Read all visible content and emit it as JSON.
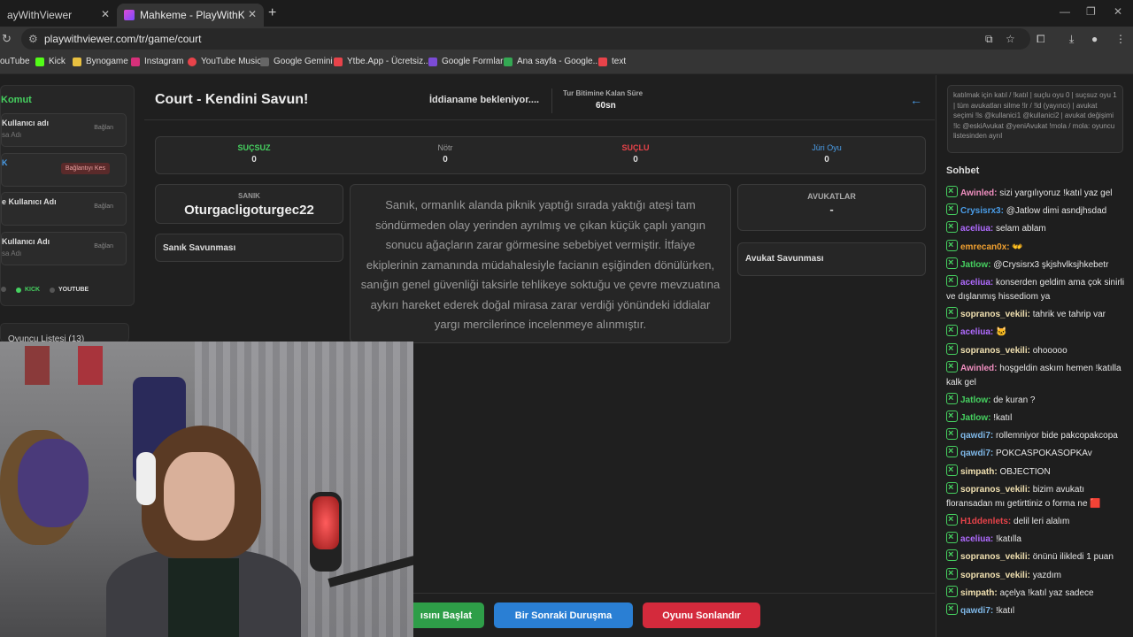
{
  "browser": {
    "tabs": [
      {
        "label": "ayWithViewer"
      },
      {
        "label": "Mahkeme - PlayWithKick | Play"
      }
    ],
    "url": "playwithviewer.com/tr/game/court",
    "bookmarks": [
      "ouTube",
      "Kick",
      "Bynogame",
      "Instagram",
      "YouTube Music",
      "Google Gemini",
      "Ytbe.App - Ücretsiz...",
      "Google Formlar",
      "Ana sayfa - Google...",
      "text"
    ]
  },
  "left_panel": {
    "title": "Komut",
    "fields": [
      {
        "label": "Kullanıcı adı",
        "placeholder": "sa Adı",
        "button": "Bağlan"
      },
      {
        "label": "K",
        "placeholder": "",
        "button": "Bağlantıyı Kes"
      },
      {
        "label": "e Kullanıcı Adı",
        "placeholder": "",
        "button": "Bağlan"
      },
      {
        "label": "Kullanıcı Adı",
        "placeholder": "sa Adı",
        "button": "Bağlan"
      }
    ],
    "platforms": [
      "KICK",
      "YOUTUBE"
    ],
    "players": "Oyuncu Listesi (13)"
  },
  "header": {
    "title": "Court - Kendini Savun!",
    "status": "İddianame bekleniyor....",
    "timer_label": "Tur Bitimine Kalan Süre",
    "timer_value": "60sn"
  },
  "votes": [
    {
      "label": "SUÇSUZ",
      "count": "0",
      "color": "#46d160"
    },
    {
      "label": "Nötr",
      "count": "0",
      "color": "#9a9a9a"
    },
    {
      "label": "SUÇLU",
      "count": "0",
      "color": "#e8434a"
    },
    {
      "label": "Jüri Oyu",
      "count": "0",
      "color": "#4a9de8"
    }
  ],
  "defendant": {
    "label": "SANIK",
    "name": "Oturgacligoturgec22",
    "defense_title": "Sanık Savunması"
  },
  "indictment": "Sanık, ormanlık alanda piknik yaptığı sırada yaktığı ateşi tam söndürmeden olay yerinden ayrılmış ve çıkan küçük çaplı yangın sonucu ağaçların zarar görmesine sebebiyet vermiştir. İtfaiye ekiplerinin zamanında müdahalesiyle facianın eşiğinden dönülürken, sanığın genel güvenliği taksirle tehlikeye soktuğu ve çevre mevzuatına aykırı hareket ederek doğal mirasa zarar verdiği yönündeki iddialar yargı mercilerince incelenmeye alınmıştır.",
  "lawyers": {
    "label": "AVUKATLAR",
    "value": "-",
    "defense_title": "Avukat Savunması"
  },
  "buttons": {
    "start": "ısını Başlat",
    "next": "Bir Sonraki Duruşma",
    "end": "Oyunu Sonlandır"
  },
  "commands_text": "katılmak için katıl / !katıl | suçlu oyu 0 | suçsuz oyu 1 | tüm avukatları silme !lr / !ld (yayıncı) | avukat seçimi !ls @kullanici1 @kullanici2 | avukat değişimi !lc @eskiAvukat @yeniAvukat !mola / mola: oyuncu listesinden ayrıl",
  "chat": {
    "title": "Sohbet",
    "messages": [
      {
        "user": "Awinled:",
        "color": "#f08fc0",
        "text": " sizi yargılıyoruz !katıl yaz gel"
      },
      {
        "user": "Crysisrx3:",
        "color": "#4a9de8",
        "text": " @Jatlow dimi asndjhsdad"
      },
      {
        "user": "aceliua:",
        "color": "#b06bff",
        "text": " selam ablam"
      },
      {
        "user": "emrecan0x:",
        "color": "#f0a030",
        "text": " 👐"
      },
      {
        "user": "Jatlow:",
        "color": "#46d160",
        "text": " @Crysisrx3 şkjshvlksjhkebetr"
      },
      {
        "user": "aceliua:",
        "color": "#b06bff",
        "text": " konserden geldim ama çok sinirli ve dışlanmış hissediom ya"
      },
      {
        "user": "sopranos_vekili:",
        "color": "#f0e0b0",
        "text": " tahrik ve tahrip var"
      },
      {
        "user": "aceliua:",
        "color": "#b06bff",
        "text": " 🐱"
      },
      {
        "user": "sopranos_vekili:",
        "color": "#f0e0b0",
        "text": " ohooooo"
      },
      {
        "user": "Awinled:",
        "color": "#f08fc0",
        "text": " hoşgeldin askım hemen !katılla kalk gel"
      },
      {
        "user": "Jatlow:",
        "color": "#46d160",
        "text": " de kuran ?"
      },
      {
        "user": "Jatlow:",
        "color": "#46d160",
        "text": " !katıl"
      },
      {
        "user": "qawdi7:",
        "color": "#7fb8e8",
        "text": " rollemniyor bide pakcopakcopa"
      },
      {
        "user": "qawdi7:",
        "color": "#7fb8e8",
        "text": " POKCASPOKASOPKAv"
      },
      {
        "user": "simpath:",
        "color": "#f0e0b0",
        "text": " OBJECTION"
      },
      {
        "user": "sopranos_vekili:",
        "color": "#f0e0b0",
        "text": " bizim avukatı floransadan mı getirttiniz o forma ne 🟥"
      },
      {
        "user": "H1ddenlets:",
        "color": "#e8434a",
        "text": " delil leri alalım"
      },
      {
        "user": "aceliua:",
        "color": "#b06bff",
        "text": " !katılla"
      },
      {
        "user": "sopranos_vekili:",
        "color": "#f0e0b0",
        "text": " önünü ilikledi 1 puan"
      },
      {
        "user": "sopranos_vekili:",
        "color": "#f0e0b0",
        "text": " yazdım"
      },
      {
        "user": "simpath:",
        "color": "#f0e0b0",
        "text": " açelya !katıl yaz sadece"
      },
      {
        "user": "qawdi7:",
        "color": "#7fb8e8",
        "text": " !katıl"
      }
    ]
  }
}
